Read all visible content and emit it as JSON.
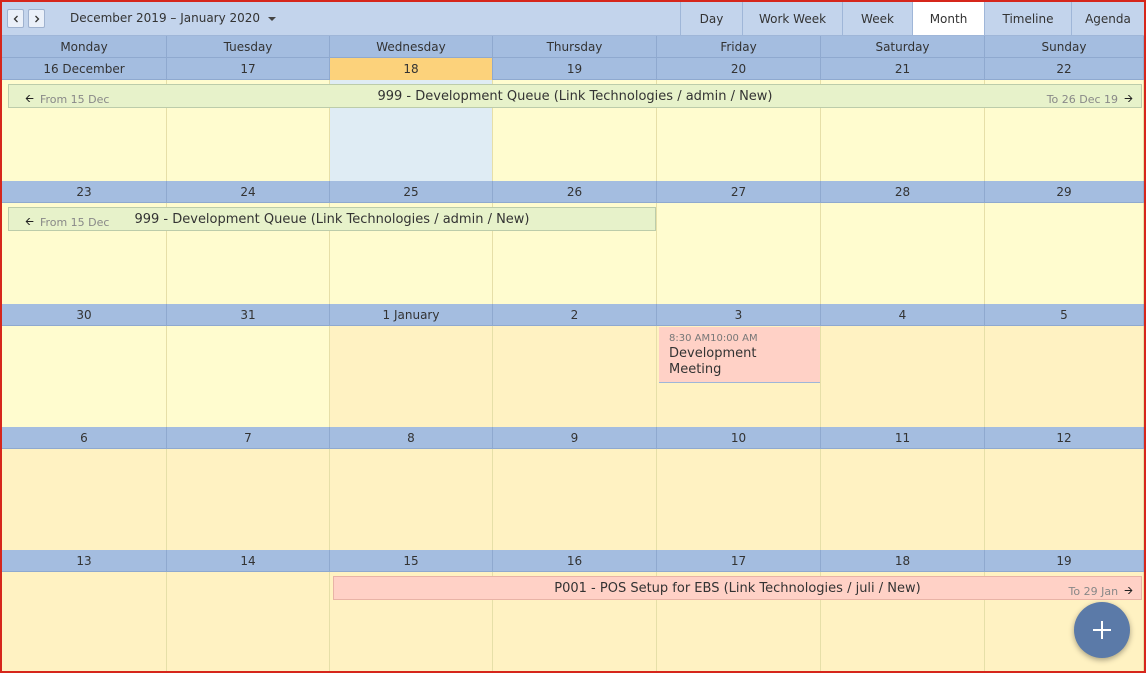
{
  "toolbar": {
    "date_range": "December 2019 – January 2020",
    "views": [
      "Day",
      "Work Week",
      "Week",
      "Month",
      "Timeline",
      "Agenda"
    ],
    "active_view": "Month"
  },
  "day_names": [
    "Monday",
    "Tuesday",
    "Wednesday",
    "Thursday",
    "Friday",
    "Saturday",
    "Sunday"
  ],
  "weeks": [
    {
      "dates": [
        "16 December",
        "17",
        "18",
        "19",
        "20",
        "21",
        "22"
      ]
    },
    {
      "dates": [
        "23",
        "24",
        "25",
        "26",
        "27",
        "28",
        "29"
      ]
    },
    {
      "dates": [
        "30",
        "31",
        "1 January",
        "2",
        "3",
        "4",
        "5"
      ]
    },
    {
      "dates": [
        "6",
        "7",
        "8",
        "9",
        "10",
        "11",
        "12"
      ]
    },
    {
      "dates": [
        "13",
        "14",
        "15",
        "16",
        "17",
        "18",
        "19"
      ]
    }
  ],
  "today_label": "18",
  "events": {
    "queue_week1": {
      "from": "From 15 Dec",
      "title": "999 - Development Queue (Link Technologies / admin / New)",
      "to": "To 26 Dec 19"
    },
    "queue_week2": {
      "from": "From 15 Dec",
      "title": "999 - Development Queue (Link Technologies / admin / New)"
    },
    "meeting": {
      "time": "8:30 AM10:00 AM",
      "title": "Development Meeting"
    },
    "pos_setup": {
      "title": "P001 - POS Setup for EBS (Link Technologies / juli / New)",
      "to": "To 29 Jan"
    }
  },
  "colors": {
    "today": "#fcd27b",
    "header": "#a4bde0",
    "toolbar": "#c3d4ec",
    "fab": "#5b7aa8"
  }
}
